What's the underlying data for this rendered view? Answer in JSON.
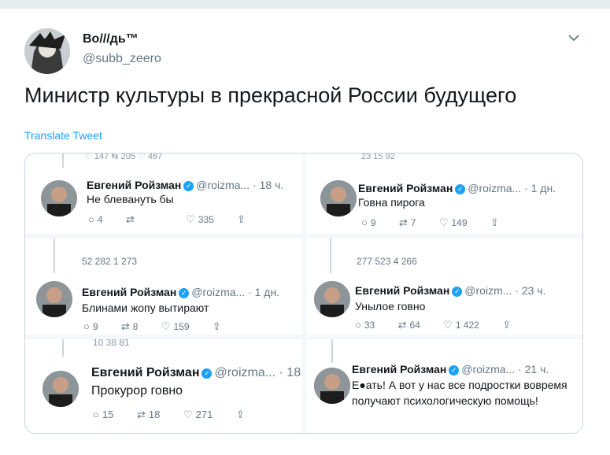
{
  "tweet": {
    "display_name": "Во///дь™",
    "handle": "@subb_zeero",
    "text": "Министр культуры в прекрасной России будущего",
    "translate_label": "Translate Tweet"
  },
  "screenshots": [
    {
      "name": "Евгений Ройзман",
      "meta": "@roizma... · 18 ч.",
      "text": "Не блевануть бы",
      "top_counts": "♡ 147   ⇆ 205   ♡ 467",
      "actions": {
        "replies": "4",
        "retweets": "",
        "likes": "335"
      }
    },
    {
      "name": "Евгений Ройзман",
      "meta": "@roizma... · 1 дн.",
      "text": "Говна пирога",
      "top_counts": "23   15   92",
      "actions": {
        "replies": "9",
        "retweets": "7",
        "likes": "149"
      }
    },
    {
      "name": "Евгений Ройзман",
      "meta": "@roizma... · 1 дн.",
      "text": "Блинами жопу вытирают",
      "top_counts": "52   282   1 273",
      "actions": {
        "replies": "9",
        "retweets": "8",
        "likes": "159"
      }
    },
    {
      "name": "Евгений Ройзман",
      "meta": "@roizm... · 23 ч.",
      "text": "Унылое говно",
      "top_counts": "277   523   4 266",
      "actions": {
        "replies": "33",
        "retweets": "64",
        "likes": "1 422"
      }
    },
    {
      "name": "Евгений Ройзман",
      "meta": "@roizma... · 18",
      "text": "Прокурор говно",
      "top_counts": "10   38   81",
      "actions": {
        "replies": "15",
        "retweets": "18",
        "likes": "271"
      }
    },
    {
      "name": "Евгений Ройзман",
      "meta": "@roizma... · 21 ч.",
      "text": "Е●ать! А вот у нас все подростки вовремя получают психологическую помощь!",
      "top_counts": "",
      "actions": {
        "replies": "",
        "retweets": "",
        "likes": ""
      }
    }
  ],
  "icons": {
    "reply": "○",
    "retweet": "⇄",
    "like": "♡",
    "share": "⇪"
  }
}
